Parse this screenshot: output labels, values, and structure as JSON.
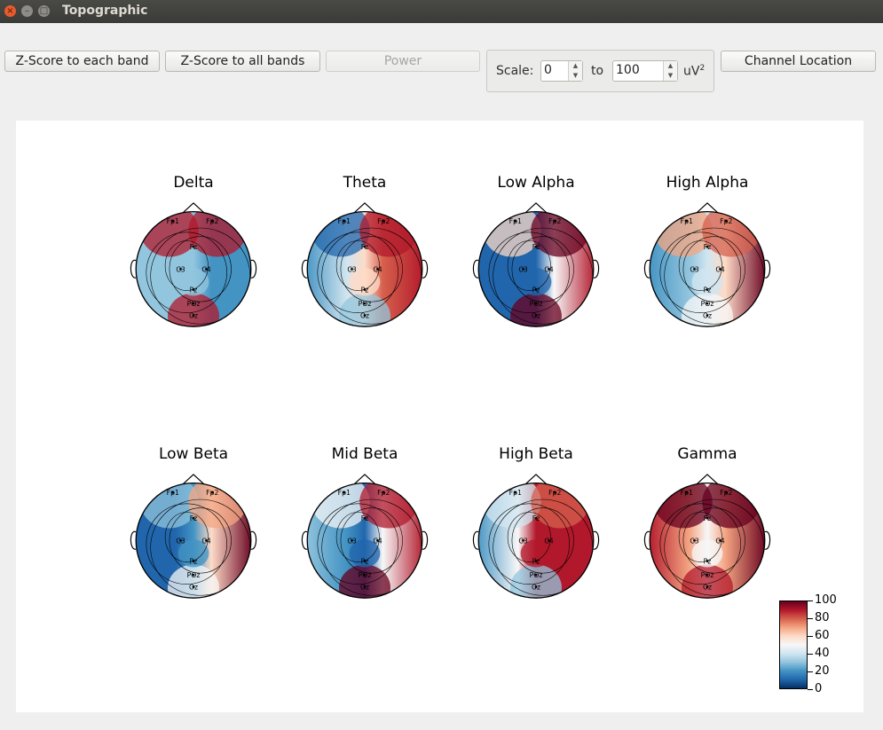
{
  "window": {
    "title": "Topographic"
  },
  "toolbar": {
    "zscore_each_label": "Z-Score to each band",
    "zscore_all_label": "Z-Score to all bands",
    "power_label": "Power",
    "channel_location_label": "Channel Location"
  },
  "scale": {
    "label": "Scale:",
    "min_value": "0",
    "to_label": "to",
    "max_value": "100",
    "unit": "uV",
    "unit_sup": "2"
  },
  "plots": [
    {
      "title": "Delta",
      "pattern": "0.9,0.85,0.3,0.2,0.25,0.9"
    },
    {
      "title": "Theta",
      "pattern": "0.1,0.85,0.2,0.9,0.6,0.3"
    },
    {
      "title": "Low Alpha",
      "pattern": "0.6,0.95,0.1,0.9,0.05,0.95"
    },
    {
      "title": "High Alpha",
      "pattern": "0.7,0.8,0.15,0.95,0.35,0.5"
    },
    {
      "title": "Low Beta",
      "pattern": "0.3,0.7,0.05,0.95,0.2,0.5"
    },
    {
      "title": "Mid Beta",
      "pattern": "0.45,0.85,0.3,0.9,0.1,0.95"
    },
    {
      "title": "High Beta",
      "pattern": "0.35,0.8,0.15,0.9,0.9,0.3"
    },
    {
      "title": "Gamma",
      "pattern": "0.95,0.95,0.9,0.95,0.5,0.9"
    }
  ],
  "electrodes": [
    "Fp1",
    "Fp2",
    "Fz",
    "C3",
    "C4",
    "Pz",
    "POz",
    "Oz"
  ],
  "colorbar": {
    "ticks": [
      "100",
      "80",
      "60",
      "40",
      "20",
      "0"
    ]
  },
  "colors": {
    "low": "#053061",
    "mid": "#f7f7f7",
    "high": "#67001f"
  }
}
